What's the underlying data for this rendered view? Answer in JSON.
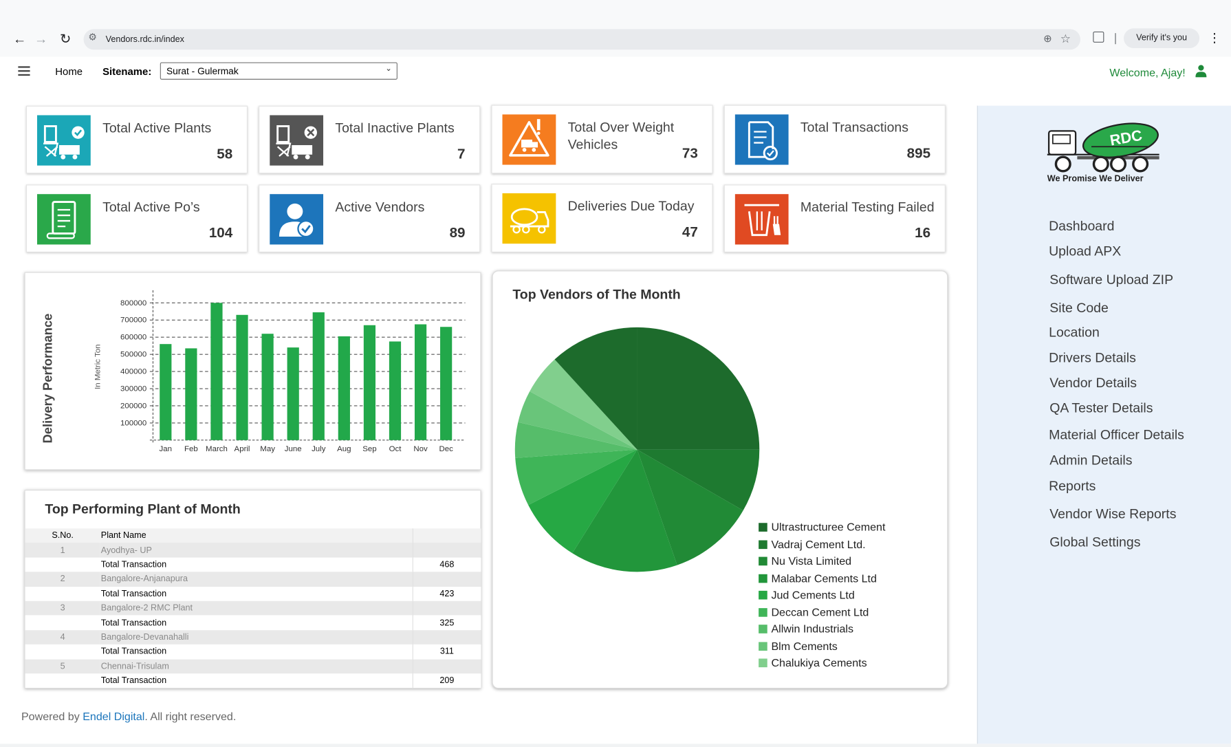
{
  "browser": {
    "url": "Vendors.rdc.in/index",
    "verify_label": "Verify it's you"
  },
  "header": {
    "home_label": "Home",
    "sitename_label": "Sitename:",
    "sitename_value": "Surat - Gulermak",
    "welcome": "Welcome, Ajay!"
  },
  "cards": [
    {
      "title": "Total Active Plants",
      "value": "58",
      "color": "#1ba7b7",
      "icon": "plant-check-icon"
    },
    {
      "title": "Total Inactive Plants",
      "value": "7",
      "color": "#555555",
      "icon": "plant-cross-icon"
    },
    {
      "title": "Total Over Weight Vehicles",
      "value": "73",
      "color": "#f57c1f",
      "icon": "overweight-truck-warning-icon"
    },
    {
      "title": "Total Transactions",
      "value": "895",
      "color": "#1d75bb",
      "icon": "document-check-icon"
    },
    {
      "title": "Total Active Po’s",
      "value": "104",
      "color": "#2aa84a",
      "icon": "purchase-order-list-icon"
    },
    {
      "title": "Active Vendors",
      "value": "89",
      "color": "#1d75bb",
      "icon": "vendor-user-check-icon"
    },
    {
      "title": "Deliveries Due Today",
      "value": "47",
      "color": "#f5c200",
      "icon": "mixer-truck-icon"
    },
    {
      "title": "Material Testing Failed",
      "value": "16",
      "color": "#e04a22",
      "icon": "lab-testing-icon"
    }
  ],
  "delivery_panel": {
    "side_label": "Delivery Performance"
  },
  "chart_data": [
    {
      "type": "bar",
      "title": "",
      "xlabel": "",
      "ylabel": "In Metric Ton",
      "categories": [
        "Jan",
        "Feb",
        "March",
        "April",
        "May",
        "June",
        "July",
        "Aug",
        "Sep",
        "Oct",
        "Nov",
        "Dec"
      ],
      "values": [
        560000,
        535000,
        800000,
        730000,
        620000,
        540000,
        745000,
        605000,
        670000,
        575000,
        675000,
        660000
      ],
      "ylim": [
        0,
        800000
      ],
      "yticks": [
        "100000",
        "200000",
        "300000",
        "400000",
        "500000",
        "600000",
        "700000",
        "800000"
      ],
      "grid": true,
      "bar_color": "#22a84a"
    },
    {
      "type": "pie",
      "title": "Top Vendors of The Month",
      "legend_position": "bottom-right",
      "slices": [
        {
          "label": "Ultrastructuree Cement",
          "value": 25,
          "color": "#1d6b2c"
        },
        {
          "label": "Vadraj Cement Ltd.",
          "value": 8.3,
          "color": "#1e7a30"
        },
        {
          "label": "Nu Vista Limited",
          "value": 11.4,
          "color": "#218a36"
        },
        {
          "label": "Malabar Cements Ltd",
          "value": 14.2,
          "color": "#22963b"
        },
        {
          "label": "Jud Cements Ltd",
          "value": 8.6,
          "color": "#26a844"
        },
        {
          "label": "Deccan Cement Ltd",
          "value": 6.4,
          "color": "#3fb558"
        },
        {
          "label": "Allwin Industrials",
          "value": 4.7,
          "color": "#56bd6a"
        },
        {
          "label": "Blm Cements",
          "value": 4.3,
          "color": "#69c57a"
        },
        {
          "label": "Chalukiya Cements",
          "value": 5.3,
          "color": "#81cf8d"
        },
        {
          "label": "",
          "value": 11.8,
          "color": "#1d6b2c"
        }
      ]
    }
  ],
  "top_plants": {
    "title": "Top Performing Plant of Month",
    "col_sno": "S.No.",
    "col_name": "Plant Name",
    "tx_label": "Total Transaction",
    "rows": [
      {
        "sno": "1",
        "name": "Ayodhya- UP",
        "total": "468"
      },
      {
        "sno": "2",
        "name": "Bangalore-Anjanapura",
        "total": "423"
      },
      {
        "sno": "3",
        "name": "Bangalore-2 RMC Plant",
        "total": "325"
      },
      {
        "sno": "4",
        "name": "Bangalore-Devanahalli",
        "total": "311"
      },
      {
        "sno": "5",
        "name": "Chennai-Trisulam",
        "total": "209"
      }
    ]
  },
  "sidebar": {
    "logo_badge": "RDC",
    "logo_tagline": "We Promise We Deliver",
    "items": [
      "Dashboard",
      "Upload APX",
      "Software Upload ZIP",
      "Site Code",
      "Location",
      "Drivers Details",
      "Vendor Details",
      "QA Tester Details",
      "Material Officer Details",
      "Admin Details",
      "Reports",
      "Vendor Wise Reports",
      "Global Settings"
    ]
  },
  "footer": {
    "prefix": "Powered by ",
    "link": "Endel Digital",
    "suffix": ". All right reserved."
  }
}
